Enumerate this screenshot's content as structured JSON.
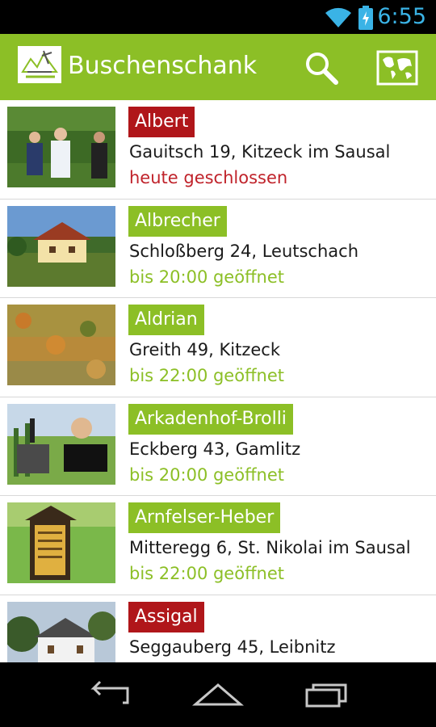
{
  "status_bar": {
    "time": "6:55",
    "icons": [
      "wifi-icon",
      "battery-charging-icon"
    ]
  },
  "action_bar": {
    "title": "Buschenschank",
    "color": "#8cbf26",
    "icons": [
      "app-logo-icon",
      "search-icon",
      "map-icon"
    ]
  },
  "list": [
    {
      "name": "Albert",
      "address": "Gauitsch 19, Kitzeck im Sausal",
      "status": "heute geschlossen",
      "state": "closed"
    },
    {
      "name": "Albrecher",
      "address": "Schloßberg 24, Leutschach",
      "status": "bis 20:00 geöffnet",
      "state": "open"
    },
    {
      "name": "Aldrian",
      "address": "Greith 49, Kitzeck",
      "status": "bis 22:00 geöffnet",
      "state": "open"
    },
    {
      "name": "Arkadenhof-Brolli",
      "address": "Eckberg 43, Gamlitz",
      "status": "bis 20:00 geöffnet",
      "state": "open"
    },
    {
      "name": "Arnfelser-Heber",
      "address": "Mitteregg 6,  St. Nikolai im Sausal",
      "status": "bis 22:00 geöffnet",
      "state": "open"
    },
    {
      "name": "Assigal",
      "address": "Seggauberg 45, Leibnitz",
      "status": "",
      "state": "closed"
    }
  ],
  "colors": {
    "open": "#8cbf26",
    "closed": "#b0161a",
    "accent_time": "#3ab3e6"
  },
  "nav_bar": {
    "icons": [
      "back-icon",
      "home-icon",
      "recents-icon"
    ]
  }
}
